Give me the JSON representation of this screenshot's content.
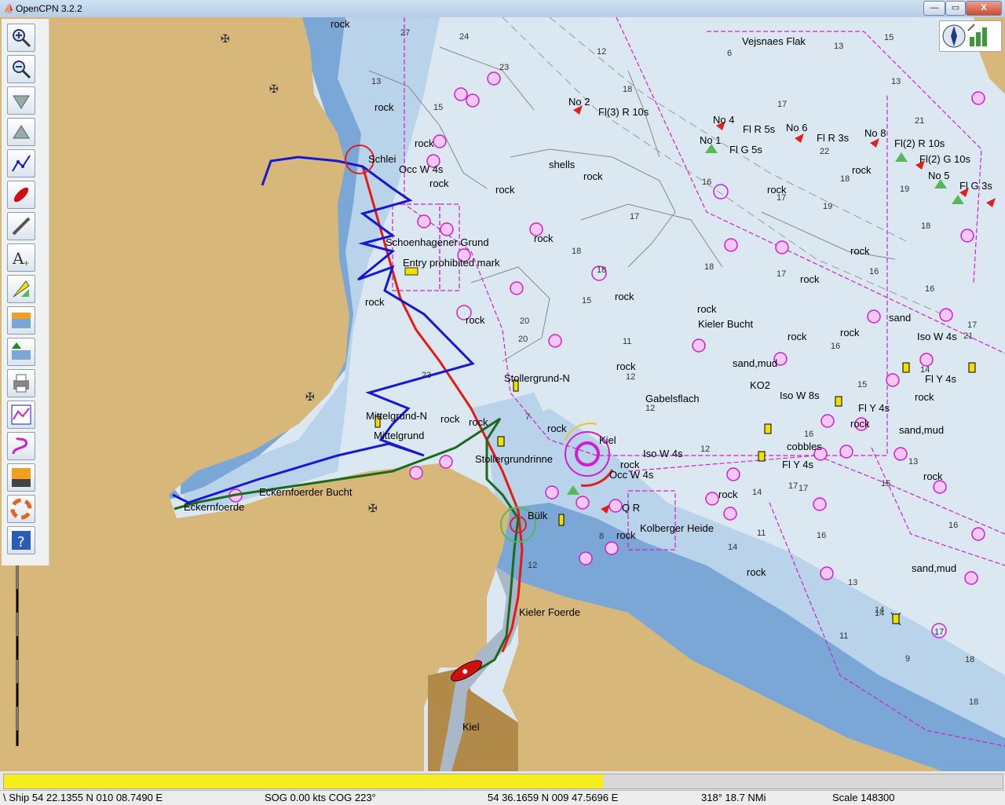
{
  "window": {
    "title": "OpenCPN 3.2.2",
    "minimize": "—",
    "maximize": "▭",
    "close": "X"
  },
  "toolbar": {
    "tools": [
      {
        "name": "zoom-in-icon"
      },
      {
        "name": "zoom-out-icon"
      },
      {
        "name": "scale-down-icon"
      },
      {
        "name": "scale-up-icon"
      },
      {
        "name": "route-icon"
      },
      {
        "name": "ship-icon"
      },
      {
        "name": "measure-icon"
      },
      {
        "name": "text-icon"
      },
      {
        "name": "mark-icon"
      },
      {
        "name": "tide-icon"
      },
      {
        "name": "current-icon"
      },
      {
        "name": "print-icon"
      },
      {
        "name": "route-manager-icon"
      },
      {
        "name": "track-icon"
      },
      {
        "name": "color-scheme-icon"
      },
      {
        "name": "mob-icon"
      },
      {
        "name": "help-icon"
      }
    ]
  },
  "chart": {
    "place_labels": [
      {
        "text": "Vejsnaes Flak",
        "name": "place-label-vejsnaes-flak"
      },
      {
        "text": "Schlei",
        "name": "place-label-schlei"
      },
      {
        "text": "Occ W 4s",
        "name": "light-label-occ-schlei"
      },
      {
        "text": "Schoenhagener Grund",
        "name": "place-label-schoenhagener-grund"
      },
      {
        "text": "Entry prohibited mark",
        "name": "mark-label-entry-prohibited"
      },
      {
        "text": "Stollergrund-N",
        "name": "place-label-stollergrund-n"
      },
      {
        "text": "Mittelgrund-N",
        "name": "place-label-mittelgrund-n"
      },
      {
        "text": "Mittelgrund",
        "name": "place-label-mittelgrund"
      },
      {
        "text": "Stollergrundrinne",
        "name": "place-label-stollergrundrinne"
      },
      {
        "text": "Eckernfoerder Bucht",
        "name": "place-label-eckernfoerder-bucht"
      },
      {
        "text": "Eckernfoerde",
        "name": "place-label-eckernfoerde"
      },
      {
        "text": "Kieler Bucht",
        "name": "place-label-kieler-bucht"
      },
      {
        "text": "Gabelsflach",
        "name": "place-label-gabelsflach"
      },
      {
        "text": "Kiel",
        "name": "place-label-kiel-light"
      },
      {
        "text": "Iso W 4s",
        "name": "light-label-iso-kiel"
      },
      {
        "text": "Occ W 4s",
        "name": "light-label-occ-kiel"
      },
      {
        "text": "Q R",
        "name": "light-label-q-r"
      },
      {
        "text": "Kolberger Heide",
        "name": "place-label-kolberger-heide"
      },
      {
        "text": "Bülk",
        "name": "place-label-bulk"
      },
      {
        "text": "Kieler Foerde",
        "name": "place-label-kieler-foerde"
      },
      {
        "text": "Kiel",
        "name": "place-label-kiel-city"
      },
      {
        "text": "shells",
        "name": "seabed-label-shells"
      },
      {
        "text": "sand,mud",
        "name": "seabed-label-sand-mud-1"
      },
      {
        "text": "sand,mud",
        "name": "seabed-label-sand-mud-2"
      },
      {
        "text": "sand,mud",
        "name": "seabed-label-sand-mud-3"
      },
      {
        "text": "cobbles",
        "name": "seabed-label-cobbles"
      },
      {
        "text": "sand",
        "name": "seabed-label-sand"
      },
      {
        "text": "No 2",
        "name": "buoy-label-no2"
      },
      {
        "text": "Fl(3) R 10s",
        "name": "light-label-fl3-r"
      },
      {
        "text": "No 4",
        "name": "buoy-label-no4"
      },
      {
        "text": "Fl R 5s",
        "name": "light-label-fl-r-5s"
      },
      {
        "text": "No 6",
        "name": "buoy-label-no6"
      },
      {
        "text": "Fl R 3s",
        "name": "light-label-fl-r-3s"
      },
      {
        "text": "No 8",
        "name": "buoy-label-no8"
      },
      {
        "text": "Fl(2) R 10s",
        "name": "light-label-fl2-r"
      },
      {
        "text": "No 1",
        "name": "buoy-label-no1"
      },
      {
        "text": "Fl G 5s",
        "name": "light-label-fl-g-5s"
      },
      {
        "text": "Fl(2) G 10s",
        "name": "light-label-fl2-g"
      },
      {
        "text": "No 5",
        "name": "buoy-label-no5"
      },
      {
        "text": "Fl G 3s",
        "name": "light-label-fl-g-3s"
      },
      {
        "text": "Iso W 4s",
        "name": "light-label-iso-east"
      },
      {
        "text": "Fl Y 4s",
        "name": "light-label-fl-y-1"
      },
      {
        "text": "Fl Y 4s",
        "name": "light-label-fl-y-2"
      },
      {
        "text": "Fl Y 4s",
        "name": "light-label-fl-y-3"
      },
      {
        "text": "Iso W 8s",
        "name": "light-label-iso-w-8s"
      },
      {
        "text": "KO2",
        "name": "buoy-label-ko2"
      }
    ],
    "rock_labels": [
      "rock",
      "rock",
      "rock",
      "rock",
      "rock",
      "rock",
      "rock",
      "rock",
      "rock",
      "rock",
      "rock",
      "rock",
      "rock",
      "rock",
      "rock",
      "rock",
      "rock",
      "rock",
      "rock",
      "rock",
      "rock",
      "rock",
      "rock",
      "rock",
      "rock",
      "rock",
      "rock",
      "rock"
    ],
    "soundings": [
      "27",
      "24",
      "15",
      "12",
      "13",
      "6",
      "23",
      "18",
      "15",
      "17",
      "13",
      "21",
      "18",
      "17",
      "17",
      "16",
      "18",
      "19",
      "17",
      "16",
      "18",
      "21",
      "15",
      "20",
      "11",
      "12",
      "14",
      "12",
      "16",
      "17",
      "23",
      "12",
      "14",
      "15",
      "17",
      "16",
      "18",
      "14",
      "16",
      "13",
      "16",
      "11",
      "18",
      "17",
      "13",
      "14",
      "12",
      "8",
      "7",
      "9",
      "14",
      "17",
      "11",
      "18",
      "20",
      "22",
      "13",
      "19",
      "18",
      "16",
      "15"
    ]
  },
  "compass": {
    "label": "compass-widget"
  },
  "progress": {
    "fraction": 0.6
  },
  "status": {
    "ship": "\\ Ship 54 22.1355 N   010 08.7490 E",
    "sog": "SOG 0.00 kts   COG 223°",
    "cursor": "54 36.1659 N   009 47.5696 E",
    "bearing": "318°   18.7 NMi",
    "scale": "Scale 148300"
  },
  "colors": {
    "land": "#d8b87a",
    "shallow": "#7aa7d6",
    "medium": "#b9d3ea",
    "deep": "#dbe8f2",
    "route_red": "#e8190f",
    "route_blue": "#1618d6",
    "route_green": "#1c6a1c",
    "magenta": "#d01fd0"
  }
}
